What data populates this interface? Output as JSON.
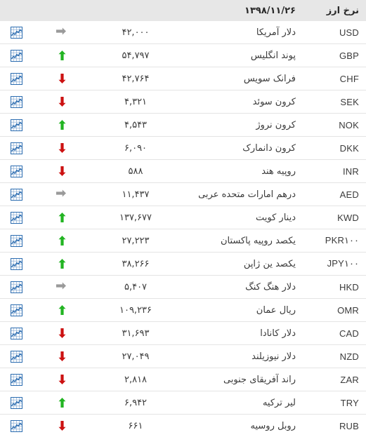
{
  "header": {
    "title": "نرخ ارز",
    "date": "۱۳۹۸/۱۱/۲۶"
  },
  "icons": {
    "rss": "rss-feed-icon",
    "chart": "chart-icon",
    "up": "arrow-up-icon",
    "down": "arrow-down-icon",
    "flat": "arrow-right-icon"
  },
  "colors": {
    "header_bg": "#e7e7e7",
    "up": "#22b422",
    "down": "#cc1111",
    "flat": "#9a9a9a",
    "rss_orange": "#e8751a",
    "chart_blue": "#2b6cb0",
    "text": "#3b3b3b",
    "row_border": "#e4e4e4"
  },
  "rows": [
    {
      "code": "USD",
      "name": "دلار آمریکا",
      "value": "۴۲,۰۰۰",
      "trend": "flat"
    },
    {
      "code": "GBP",
      "name": "پوند انگلیس",
      "value": "۵۴,۷۹۷",
      "trend": "up"
    },
    {
      "code": "CHF",
      "name": "فرانک سویس",
      "value": "۴۲,۷۶۴",
      "trend": "down"
    },
    {
      "code": "SEK",
      "name": "کرون سوئد",
      "value": "۴,۳۲۱",
      "trend": "down"
    },
    {
      "code": "NOK",
      "name": "کرون نروژ",
      "value": "۴,۵۴۳",
      "trend": "up"
    },
    {
      "code": "DKK",
      "name": "کرون دانمارک",
      "value": "۶,۰۹۰",
      "trend": "down"
    },
    {
      "code": "INR",
      "name": "روپیه هند",
      "value": "۵۸۸",
      "trend": "down"
    },
    {
      "code": "AED",
      "name": "درهم امارات متحده عربی",
      "value": "۱۱,۴۳۷",
      "trend": "flat"
    },
    {
      "code": "KWD",
      "name": "دینار کویت",
      "value": "۱۳۷,۶۷۷",
      "trend": "up"
    },
    {
      "code": "PKR۱۰۰",
      "name": "یکصد روپیه پاکستان",
      "value": "۲۷,۲۲۳",
      "trend": "up"
    },
    {
      "code": "JPY۱۰۰",
      "name": "یکصد ین ژاپن",
      "value": "۳۸,۲۶۶",
      "trend": "up"
    },
    {
      "code": "HKD",
      "name": "دلار هنگ کنگ",
      "value": "۵,۴۰۷",
      "trend": "flat"
    },
    {
      "code": "OMR",
      "name": "ریال عمان",
      "value": "۱۰۹,۲۳۶",
      "trend": "up"
    },
    {
      "code": "CAD",
      "name": "دلار کانادا",
      "value": "۳۱,۶۹۳",
      "trend": "down"
    },
    {
      "code": "NZD",
      "name": "دلار نیوزیلند",
      "value": "۲۷,۰۴۹",
      "trend": "down"
    },
    {
      "code": "ZAR",
      "name": "راند آفریقای جنوبی",
      "value": "۲,۸۱۸",
      "trend": "down"
    },
    {
      "code": "TRY",
      "name": "لیر ترکیه",
      "value": "۶,۹۴۲",
      "trend": "up"
    },
    {
      "code": "RUB",
      "name": "روبل روسیه",
      "value": "۶۶۱",
      "trend": "down"
    }
  ]
}
